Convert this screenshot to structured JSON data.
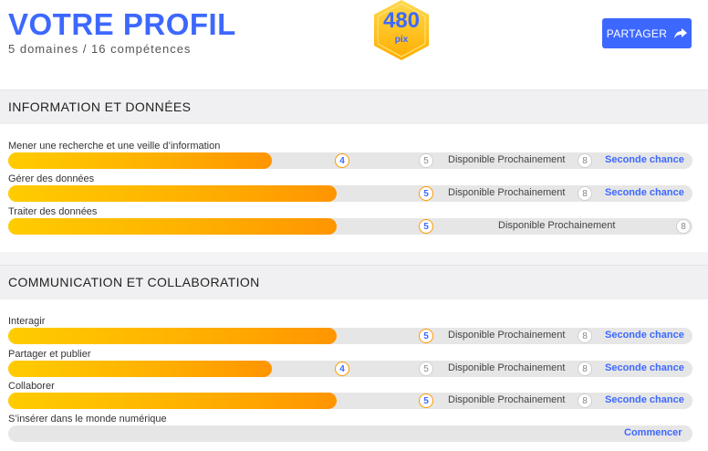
{
  "header": {
    "title": "VOTRE PROFIL",
    "subtitle": "5 domaines / 16 compétences",
    "score": "480",
    "score_unit": "pix",
    "share_label": "PARTAGER"
  },
  "colors": {
    "accent": "#3d68ff",
    "gold_light": "#ffcc00",
    "orange": "#ff9500",
    "track": "#e6e6e6"
  },
  "sections": [
    {
      "title": "INFORMATION ET DONNÉES",
      "rows": [
        {
          "label": "Mener une recherche et une veille d’information",
          "level": "4",
          "level_fraction": 0.5,
          "next_level": "5",
          "available": "Disponible Prochainement",
          "max": "8",
          "action": "Seconde chance"
        },
        {
          "label": "Gérer des données",
          "level": "5",
          "level_fraction": 0.625,
          "available": "Disponible Prochainement",
          "max": "8",
          "action": "Seconde chance"
        },
        {
          "label": "Traiter des données",
          "level": "5",
          "level_fraction": 0.625,
          "available": "Disponible Prochainement",
          "max": "8"
        }
      ]
    },
    {
      "title": "COMMUNICATION ET COLLABORATION",
      "rows": [
        {
          "label": "Interagir",
          "level": "5",
          "level_fraction": 0.625,
          "available": "Disponible Prochainement",
          "max": "8",
          "action": "Seconde chance"
        },
        {
          "label": "Partager et publier",
          "level": "4",
          "level_fraction": 0.5,
          "next_level": "5",
          "available": "Disponible Prochainement",
          "max": "8",
          "action": "Seconde chance"
        },
        {
          "label": "Collaborer",
          "level": "5",
          "level_fraction": 0.625,
          "available": "Disponible Prochainement",
          "max": "8",
          "action": "Seconde chance"
        },
        {
          "label": "S’insérer dans le monde numérique",
          "level_fraction": 0,
          "action": "Commencer"
        }
      ]
    }
  ]
}
